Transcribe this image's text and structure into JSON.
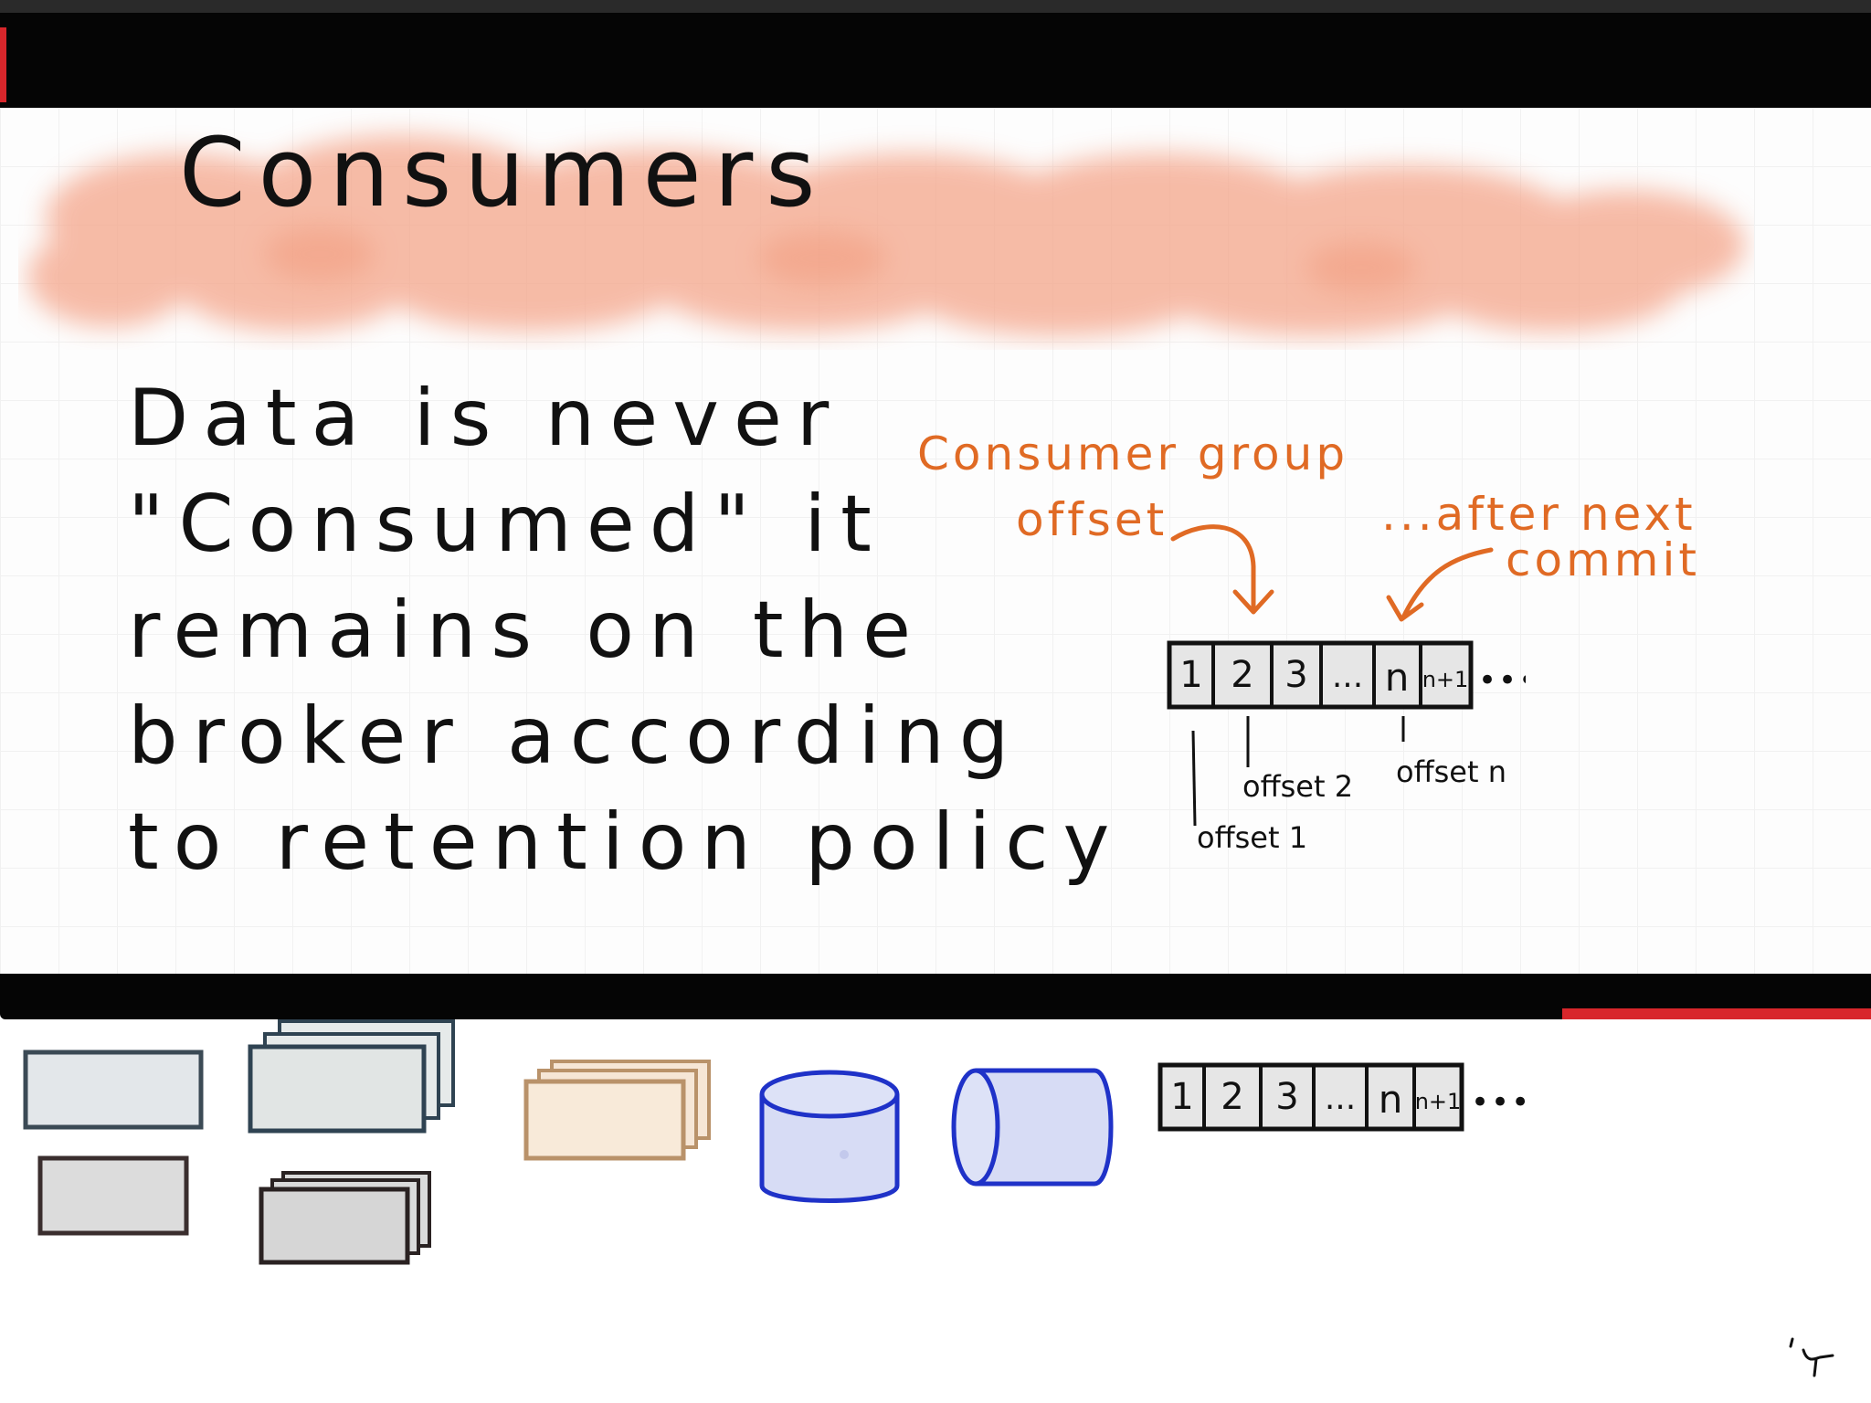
{
  "title": "Consumers",
  "body": {
    "lines": [
      "Data is never",
      "\"Consumed\" it",
      "remains on the",
      "broker according",
      "to retention policy"
    ]
  },
  "annotations": {
    "consumer_group_offset": [
      "Consumer group",
      "offset"
    ],
    "after_next_commit": [
      "...after next",
      "commit"
    ]
  },
  "log": {
    "cells": [
      "1",
      "2",
      "3",
      "...",
      "n",
      "n+1"
    ],
    "continuation": "•••",
    "offset_labels": {
      "offset1": "offset 1",
      "offset2": "offset 2",
      "offsetn": "offset n"
    }
  },
  "palette": {
    "log_cells": [
      "1",
      "2",
      "3",
      "...",
      "n",
      "n+1"
    ],
    "continuation": "•••"
  },
  "colors": {
    "annotation": "#e06a24",
    "title_wash": "#f4a58a",
    "cylinder_fill": "#d7dcf5",
    "cylinder_stroke": "#1f32c8"
  }
}
